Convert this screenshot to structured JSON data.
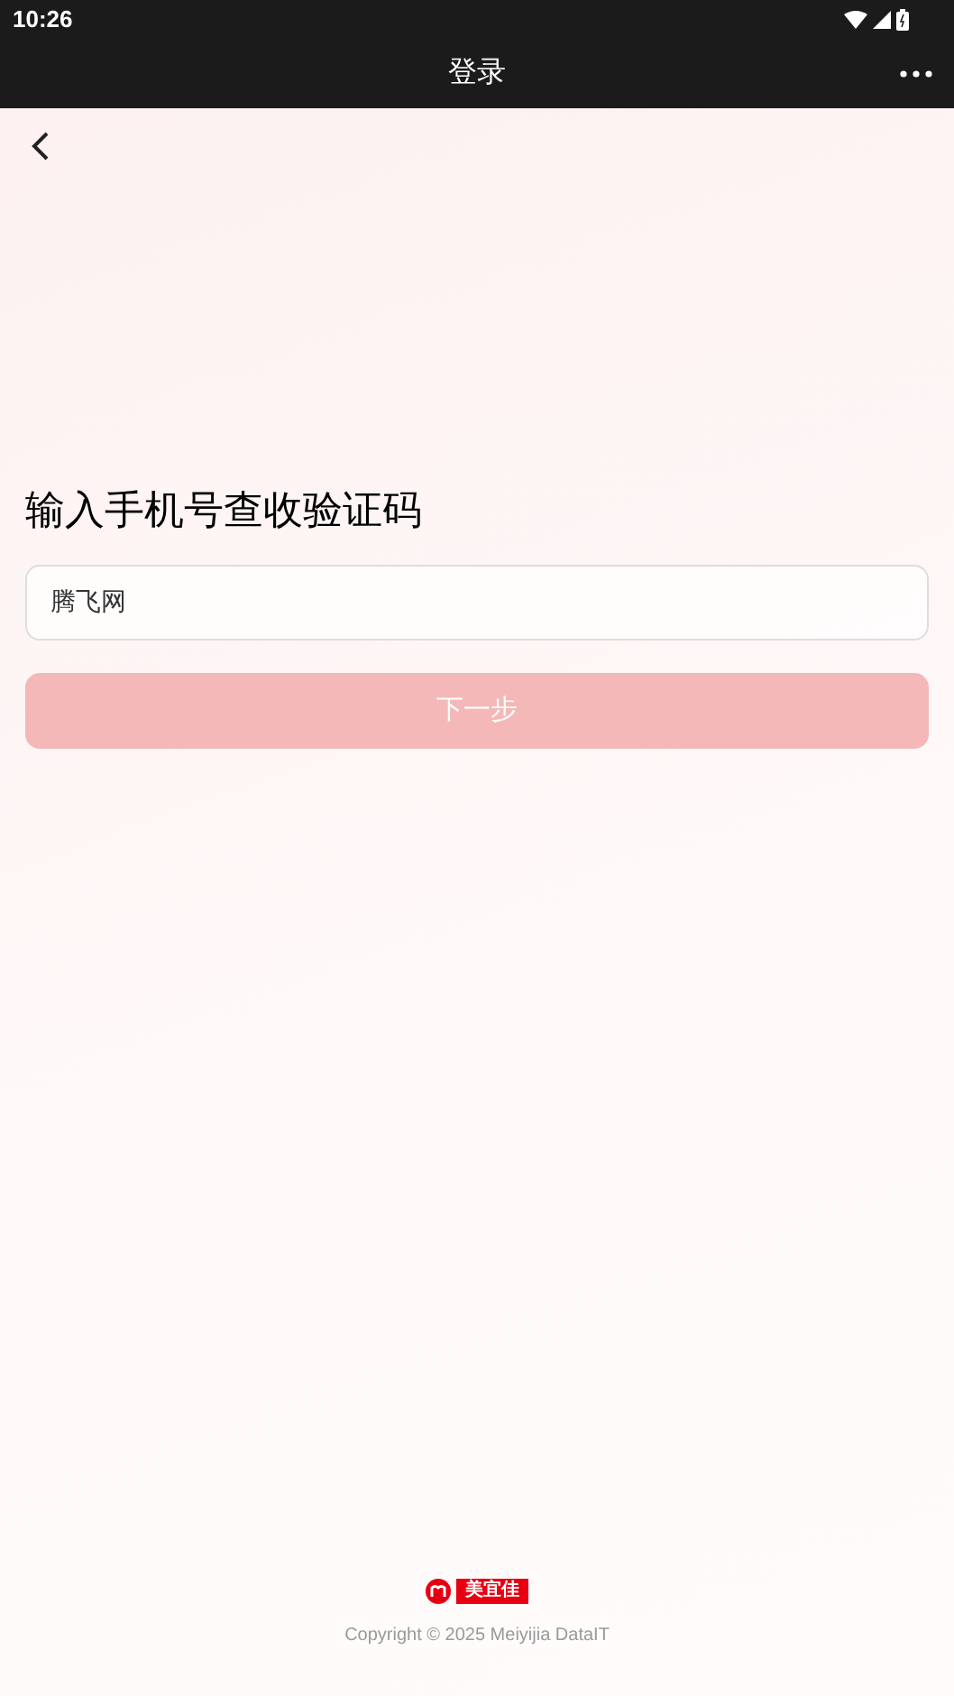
{
  "status_bar": {
    "time": "10:26"
  },
  "title_bar": {
    "title": "登录"
  },
  "heading": "输入手机号查收验证码",
  "phone_field": {
    "value": "腾飞网"
  },
  "next_button": {
    "label": "下一步",
    "disabled": true
  },
  "footer": {
    "brand": "美宜佳",
    "copyright": "Copyright © 2025 Meiyijia DataIT"
  }
}
